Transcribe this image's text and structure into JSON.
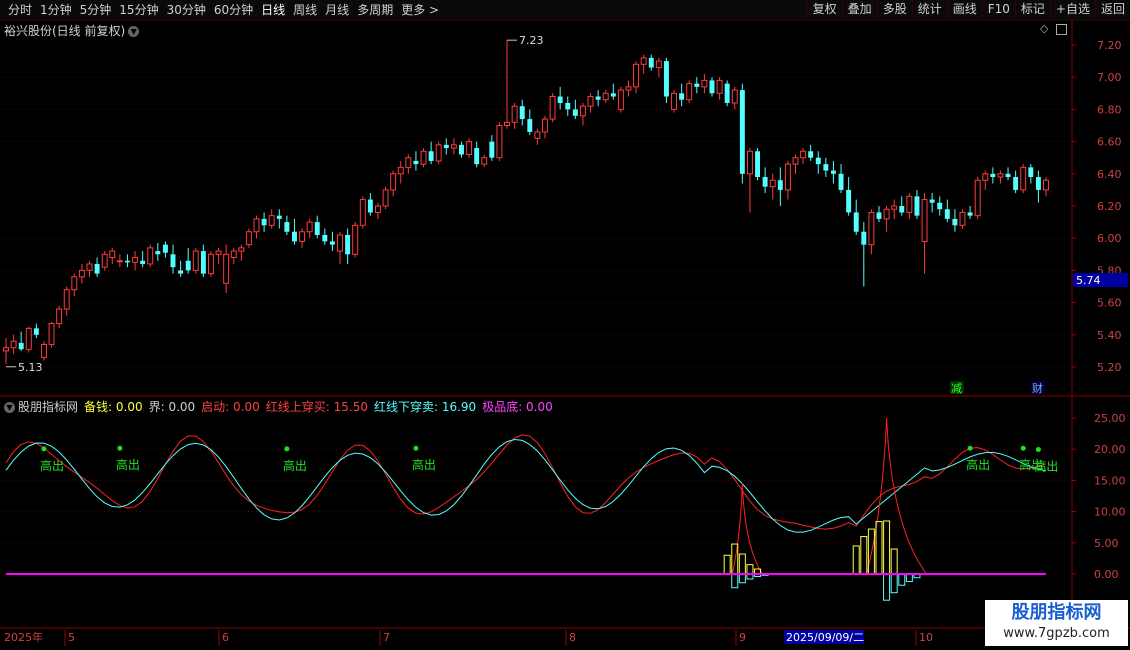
{
  "toolbar": {
    "periods": [
      "分时",
      "1分钟",
      "5分钟",
      "15分钟",
      "30分钟",
      "60分钟",
      "日线",
      "周线",
      "月线",
      "多周期",
      "更多 >"
    ],
    "active_period": "日线",
    "right_buttons": [
      "复权",
      "叠加",
      "多股",
      "统计",
      "画线",
      "F10",
      "标记",
      "+自选",
      "返回"
    ]
  },
  "kline": {
    "title": "裕兴股份(日线 前复权)",
    "price_axis": [
      "7.20",
      "7.00",
      "6.80",
      "6.60",
      "6.40",
      "6.20",
      "6.00",
      "5.80",
      "5.60",
      "5.40",
      "5.20"
    ],
    "current_price": "5.74",
    "high_label": "7.23",
    "low_label": "5.13",
    "markers": {
      "jian": "减",
      "cai": "财"
    }
  },
  "indicator": {
    "name": "股朋指标网",
    "labels": {
      "beiqian": "备钱: 0.00",
      "jie": "界: 0.00",
      "qidong": "启动: 0.00",
      "hong_up": "红线上穿买: 15.50",
      "hong_down": "红线下穿卖: 16.90",
      "jipindi": "极品底: 0.00"
    },
    "axis": [
      "25.00",
      "20.00",
      "15.00",
      "10.00",
      "5.00",
      "0.00"
    ],
    "signal_text": "高出"
  },
  "date_axis": {
    "year": "2025年",
    "months": [
      "5",
      "6",
      "7",
      "8",
      "9",
      "10"
    ],
    "highlight": "2025/09/09/二"
  },
  "watermark": {
    "line1": "股朋指标网",
    "line2": "www.7gpzb.com"
  },
  "colors": {
    "up": "#ff3b3b",
    "down": "#54ffff",
    "grid": "#5a0000",
    "pink": "#ff00ff",
    "green": "#22e022"
  },
  "chart_data": {
    "type": "candlestick",
    "ylim": [
      5.1,
      7.3
    ],
    "candles": [
      [
        5.3,
        5.38,
        5.22,
        5.32
      ],
      [
        5.32,
        5.4,
        5.28,
        5.36
      ],
      [
        5.35,
        5.42,
        5.3,
        5.31
      ],
      [
        5.31,
        5.45,
        5.29,
        5.44
      ],
      [
        5.44,
        5.47,
        5.38,
        5.4
      ],
      [
        5.26,
        5.36,
        5.24,
        5.34
      ],
      [
        5.34,
        5.48,
        5.32,
        5.47
      ],
      [
        5.47,
        5.58,
        5.44,
        5.56
      ],
      [
        5.56,
        5.7,
        5.52,
        5.68
      ],
      [
        5.68,
        5.78,
        5.64,
        5.76
      ],
      [
        5.76,
        5.84,
        5.72,
        5.8
      ],
      [
        5.8,
        5.86,
        5.76,
        5.84
      ],
      [
        5.84,
        5.88,
        5.76,
        5.78
      ],
      [
        5.82,
        5.92,
        5.8,
        5.9
      ],
      [
        5.88,
        5.94,
        5.84,
        5.92
      ],
      [
        5.86,
        5.9,
        5.82,
        5.86
      ],
      [
        5.86,
        5.9,
        5.82,
        5.85
      ],
      [
        5.85,
        5.92,
        5.8,
        5.88
      ],
      [
        5.86,
        5.92,
        5.82,
        5.84
      ],
      [
        5.84,
        5.96,
        5.82,
        5.94
      ],
      [
        5.92,
        5.97,
        5.86,
        5.9
      ],
      [
        5.96,
        5.98,
        5.88,
        5.91
      ],
      [
        5.9,
        5.96,
        5.78,
        5.82
      ],
      [
        5.8,
        5.86,
        5.76,
        5.78
      ],
      [
        5.86,
        5.94,
        5.78,
        5.8
      ],
      [
        5.8,
        5.94,
        5.78,
        5.92
      ],
      [
        5.92,
        5.96,
        5.76,
        5.78
      ],
      [
        5.78,
        5.92,
        5.76,
        5.9
      ],
      [
        5.9,
        5.94,
        5.84,
        5.92
      ],
      [
        5.72,
        5.96,
        5.66,
        5.9
      ],
      [
        5.88,
        5.94,
        5.84,
        5.92
      ],
      [
        5.92,
        5.96,
        5.86,
        5.94
      ],
      [
        5.96,
        6.06,
        5.94,
        6.04
      ],
      [
        6.04,
        6.14,
        6.0,
        6.12
      ],
      [
        6.12,
        6.16,
        6.04,
        6.08
      ],
      [
        6.08,
        6.18,
        6.06,
        6.14
      ],
      [
        6.14,
        6.18,
        6.06,
        6.12
      ],
      [
        6.1,
        6.14,
        6.02,
        6.04
      ],
      [
        6.04,
        6.12,
        5.96,
        5.98
      ],
      [
        5.98,
        6.06,
        5.94,
        6.04
      ],
      [
        6.04,
        6.12,
        6.0,
        6.1
      ],
      [
        6.1,
        6.14,
        6.0,
        6.02
      ],
      [
        6.02,
        6.06,
        5.96,
        5.98
      ],
      [
        5.98,
        6.04,
        5.92,
        5.96
      ],
      [
        5.92,
        6.04,
        5.84,
        6.02
      ],
      [
        6.02,
        6.06,
        5.84,
        5.9
      ],
      [
        5.9,
        6.1,
        5.88,
        6.08
      ],
      [
        6.08,
        6.26,
        6.06,
        6.24
      ],
      [
        6.24,
        6.28,
        6.14,
        6.16
      ],
      [
        6.16,
        6.22,
        6.12,
        6.2
      ],
      [
        6.2,
        6.32,
        6.18,
        6.3
      ],
      [
        6.3,
        6.42,
        6.26,
        6.4
      ],
      [
        6.4,
        6.48,
        6.34,
        6.44
      ],
      [
        6.44,
        6.52,
        6.4,
        6.5
      ],
      [
        6.48,
        6.54,
        6.42,
        6.46
      ],
      [
        6.46,
        6.56,
        6.44,
        6.54
      ],
      [
        6.54,
        6.6,
        6.46,
        6.48
      ],
      [
        6.48,
        6.6,
        6.46,
        6.58
      ],
      [
        6.58,
        6.62,
        6.52,
        6.56
      ],
      [
        6.56,
        6.62,
        6.52,
        6.58
      ],
      [
        6.58,
        6.6,
        6.5,
        6.52
      ],
      [
        6.52,
        6.62,
        6.5,
        6.6
      ],
      [
        6.56,
        6.6,
        6.44,
        6.46
      ],
      [
        6.46,
        6.52,
        6.44,
        6.5
      ],
      [
        6.6,
        6.64,
        6.48,
        6.5
      ],
      [
        6.5,
        6.72,
        6.48,
        6.7
      ],
      [
        6.7,
        7.23,
        6.68,
        6.72
      ],
      [
        6.72,
        6.84,
        6.68,
        6.82
      ],
      [
        6.82,
        6.86,
        6.7,
        6.74
      ],
      [
        6.74,
        6.8,
        6.64,
        6.66
      ],
      [
        6.62,
        6.68,
        6.58,
        6.66
      ],
      [
        6.66,
        6.76,
        6.62,
        6.74
      ],
      [
        6.74,
        6.9,
        6.72,
        6.88
      ],
      [
        6.88,
        6.94,
        6.8,
        6.84
      ],
      [
        6.84,
        6.88,
        6.76,
        6.8
      ],
      [
        6.8,
        6.86,
        6.74,
        6.76
      ],
      [
        6.76,
        6.84,
        6.7,
        6.82
      ],
      [
        6.82,
        6.9,
        6.78,
        6.88
      ],
      [
        6.88,
        6.92,
        6.82,
        6.86
      ],
      [
        6.86,
        6.92,
        6.84,
        6.9
      ],
      [
        6.9,
        6.96,
        6.86,
        6.88
      ],
      [
        6.8,
        6.94,
        6.78,
        6.92
      ],
      [
        6.92,
        6.98,
        6.88,
        6.94
      ],
      [
        6.94,
        7.1,
        6.9,
        7.08
      ],
      [
        7.08,
        7.14,
        7.02,
        7.12
      ],
      [
        7.12,
        7.14,
        7.04,
        7.06
      ],
      [
        7.06,
        7.12,
        7.0,
        7.1
      ],
      [
        7.1,
        7.12,
        6.84,
        6.88
      ],
      [
        6.8,
        6.92,
        6.78,
        6.9
      ],
      [
        6.9,
        6.96,
        6.82,
        6.86
      ],
      [
        6.86,
        6.98,
        6.84,
        6.96
      ],
      [
        6.96,
        7.0,
        6.9,
        6.94
      ],
      [
        6.94,
        7.02,
        6.9,
        6.98
      ],
      [
        6.98,
        7.0,
        6.88,
        6.9
      ],
      [
        6.9,
        7.0,
        6.86,
        6.98
      ],
      [
        6.96,
        6.98,
        6.82,
        6.84
      ],
      [
        6.84,
        6.94,
        6.8,
        6.92
      ],
      [
        6.92,
        6.96,
        6.34,
        6.4
      ],
      [
        6.4,
        6.56,
        6.16,
        6.54
      ],
      [
        6.54,
        6.56,
        6.36,
        6.38
      ],
      [
        6.38,
        6.44,
        6.28,
        6.32
      ],
      [
        6.32,
        6.4,
        6.24,
        6.36
      ],
      [
        6.36,
        6.44,
        6.2,
        6.3
      ],
      [
        6.3,
        6.48,
        6.24,
        6.46
      ],
      [
        6.46,
        6.52,
        6.4,
        6.5
      ],
      [
        6.5,
        6.56,
        6.46,
        6.54
      ],
      [
        6.54,
        6.58,
        6.48,
        6.5
      ],
      [
        6.5,
        6.54,
        6.4,
        6.46
      ],
      [
        6.46,
        6.5,
        6.38,
        6.42
      ],
      [
        6.42,
        6.48,
        6.34,
        6.4
      ],
      [
        6.4,
        6.46,
        6.28,
        6.3
      ],
      [
        6.3,
        6.38,
        6.14,
        6.16
      ],
      [
        6.16,
        6.24,
        6.02,
        6.04
      ],
      [
        6.04,
        6.1,
        5.7,
        5.96
      ],
      [
        5.96,
        6.18,
        5.9,
        6.16
      ],
      [
        6.16,
        6.2,
        6.1,
        6.12
      ],
      [
        6.12,
        6.2,
        6.04,
        6.18
      ],
      [
        6.18,
        6.24,
        6.12,
        6.2
      ],
      [
        6.2,
        6.26,
        6.14,
        6.16
      ],
      [
        6.16,
        6.28,
        6.12,
        6.26
      ],
      [
        6.26,
        6.3,
        6.12,
        6.14
      ],
      [
        5.98,
        6.28,
        5.78,
        6.24
      ],
      [
        6.24,
        6.28,
        6.16,
        6.22
      ],
      [
        6.22,
        6.26,
        6.14,
        6.18
      ],
      [
        6.18,
        6.24,
        6.1,
        6.12
      ],
      [
        6.12,
        6.18,
        6.04,
        6.08
      ],
      [
        6.08,
        6.18,
        6.06,
        6.16
      ],
      [
        6.16,
        6.2,
        6.12,
        6.14
      ],
      [
        6.14,
        6.38,
        6.12,
        6.36
      ],
      [
        6.36,
        6.42,
        6.3,
        6.4
      ],
      [
        6.4,
        6.44,
        6.34,
        6.38
      ],
      [
        6.38,
        6.42,
        6.34,
        6.4
      ],
      [
        6.4,
        6.44,
        6.36,
        6.38
      ],
      [
        6.38,
        6.42,
        6.28,
        6.3
      ],
      [
        6.3,
        6.46,
        6.28,
        6.44
      ],
      [
        6.44,
        6.46,
        6.34,
        6.38
      ],
      [
        6.38,
        6.42,
        6.22,
        6.3
      ],
      [
        6.3,
        6.38,
        6.26,
        6.36
      ]
    ],
    "indicator_ylim": [
      -3,
      27
    ]
  }
}
